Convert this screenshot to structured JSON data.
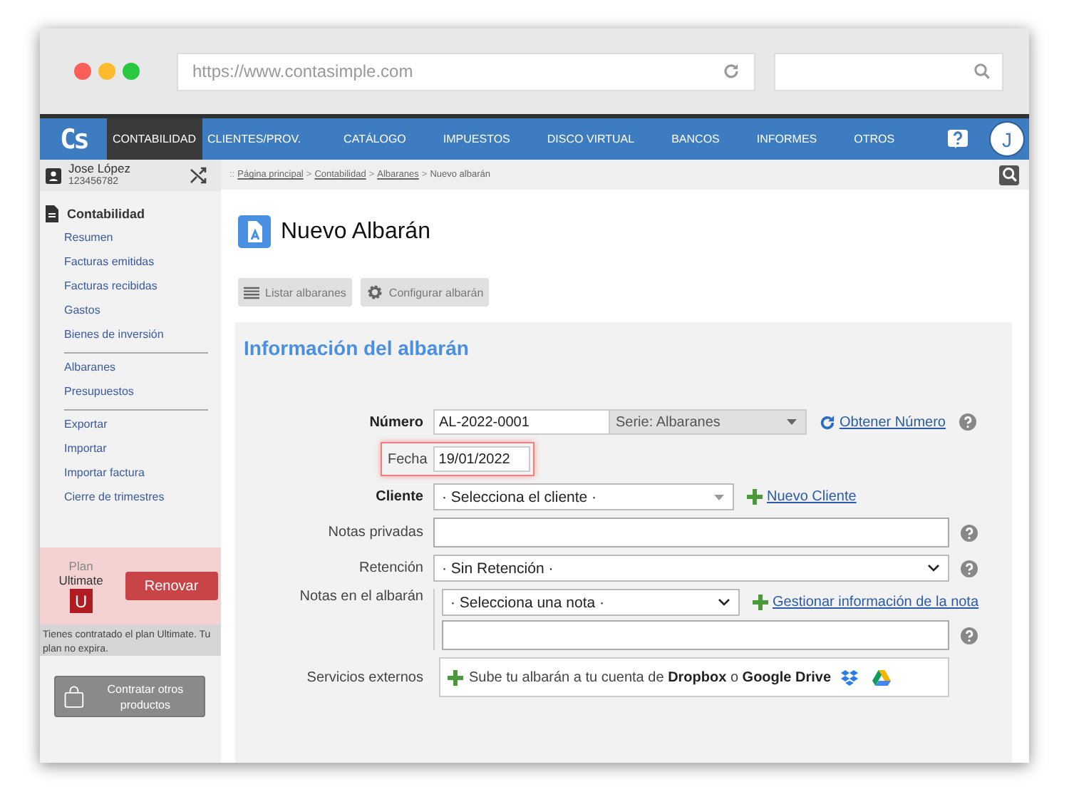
{
  "browser": {
    "url": "https://www.contasimple.com"
  },
  "nav": {
    "logo": "Cs",
    "items": [
      {
        "label": "CONTABILIDAD",
        "selected": true
      },
      {
        "label": "CLIENTES/PROV.",
        "selected": false
      },
      {
        "label": "CATÁLOGO",
        "selected": false
      },
      {
        "label": "IMPUESTOS",
        "selected": false
      },
      {
        "label": "DISCO VIRTUAL",
        "selected": false
      },
      {
        "label": "BANCOS",
        "selected": false
      },
      {
        "label": "INFORMES",
        "selected": false
      },
      {
        "label": "OTROS",
        "selected": false
      }
    ],
    "avatar": "J"
  },
  "sidebar": {
    "user": {
      "name": "Jose López",
      "id": "123456782"
    },
    "section": "Contabilidad",
    "groups": [
      [
        "Resumen",
        "Facturas emitidas",
        "Facturas recibidas",
        "Gastos",
        "Bienes de inversión"
      ],
      [
        "Albaranes",
        "Presupuestos"
      ],
      [
        "Exportar",
        "Importar",
        "Importar factura",
        "Cierre de trimestres"
      ]
    ],
    "plan": {
      "label": "Plan",
      "name": "Ultimate",
      "badge": "U",
      "button": "Renovar",
      "note": "Tienes contratado el plan Ultimate. Tu plan no expira."
    },
    "shop_button": "Contratar otros productos"
  },
  "breadcrumb": {
    "prefix": "::",
    "separator": ">",
    "links": [
      "Página principal",
      "Contabilidad",
      "Albaranes"
    ],
    "current": "Nuevo albarán"
  },
  "page_title": "Nuevo Albarán",
  "toolbar": [
    {
      "kind": "list",
      "label": "Listar albaranes"
    },
    {
      "kind": "settings",
      "label": "Configurar albarán"
    }
  ],
  "section_title": "Información del albarán",
  "form": {
    "number": {
      "label": "Número",
      "required": true,
      "value": "AL-2022-0001",
      "series": "Serie: Albaranes",
      "link": "Obtener Número"
    },
    "date": {
      "label": "Fecha",
      "required": false,
      "highlighted": true,
      "value": "19/01/2022"
    },
    "client": {
      "label": "Cliente",
      "required": true,
      "value": "· Selecciona el cliente ·",
      "link": "Nuevo Cliente"
    },
    "private_notes": {
      "label": "Notas privadas",
      "required": false
    },
    "retention": {
      "label": "Retención",
      "required": false,
      "value": "· Sin Retención ·"
    },
    "notes": {
      "label": "Notas en el albarán",
      "required": false,
      "value": "· Selecciona una nota ·",
      "link": "Gestionar información de la nota"
    },
    "services": {
      "label": "Servicios externos",
      "required": false,
      "text": "Sube tu albarán a tu cuenta de **Dropbox** o **Google Drive**"
    }
  }
}
